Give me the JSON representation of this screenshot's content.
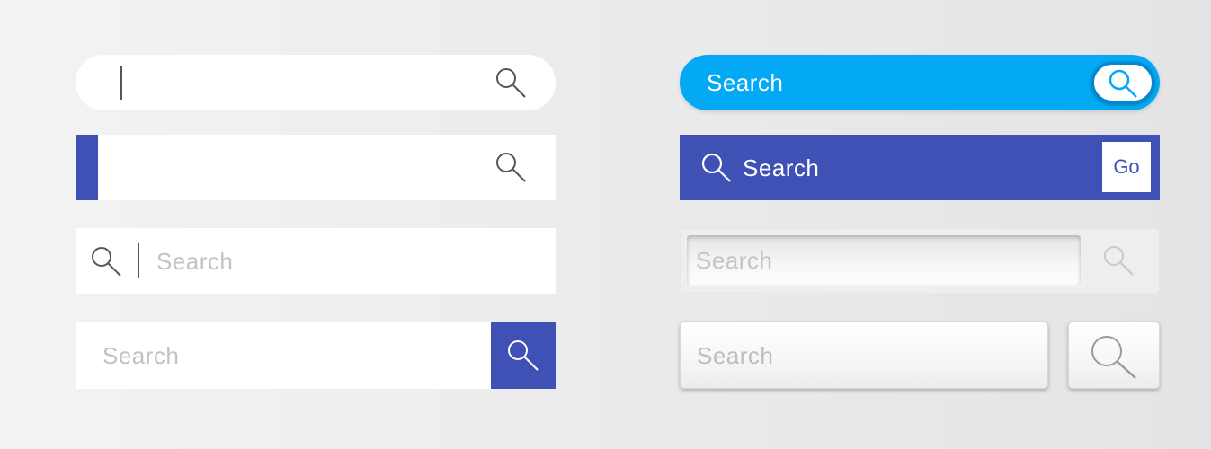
{
  "colors": {
    "background": "#eeeeee",
    "indigo_accent": "#3f51b5",
    "sky_blue": "#03a9f4",
    "placeholder_gray": "#c2c2c2"
  },
  "search_bars": [
    {
      "style": "rounded-white-with-caret",
      "icon": "search-icon"
    },
    {
      "style": "white-with-indigo-accent",
      "icon": "search-icon"
    },
    {
      "style": "white-icon-left",
      "icon": "search-icon",
      "placeholder": "Search"
    },
    {
      "style": "white-with-indigo-button",
      "icon": "search-icon",
      "placeholder": "Search"
    },
    {
      "style": "blue-pill-with-round-button",
      "icon": "search-icon",
      "label": "Search"
    },
    {
      "style": "indigo-with-go-button",
      "icon": "search-icon",
      "label": "Search",
      "button_label": "Go"
    },
    {
      "style": "inset-gray",
      "icon": "search-icon",
      "placeholder": "Search"
    },
    {
      "style": "raised-box-with-separate-button",
      "icon": "search-icon",
      "placeholder": "Search"
    }
  ]
}
